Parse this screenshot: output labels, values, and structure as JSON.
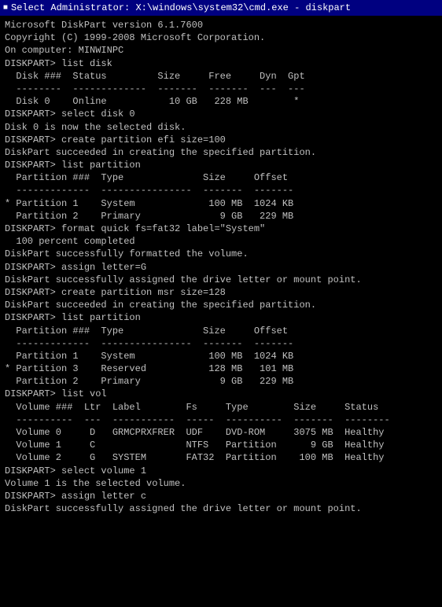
{
  "titleBar": {
    "label": "Select Administrator: X:\\windows\\system32\\cmd.exe - diskpart"
  },
  "console": {
    "lines": [
      "Microsoft DiskPart version 6.1.7600",
      "Copyright (C) 1999-2008 Microsoft Corporation.",
      "On computer: MINWINPC",
      "",
      "DISKPART> list disk",
      "",
      "  Disk ###  Status         Size     Free     Dyn  Gpt",
      "  --------  -------------  -------  -------  ---  ---",
      "  Disk 0    Online           10 GB   228 MB        *",
      "",
      "DISKPART> select disk 0",
      "",
      "Disk 0 is now the selected disk.",
      "",
      "DISKPART> create partition efi size=100",
      "",
      "DiskPart succeeded in creating the specified partition.",
      "",
      "DISKPART> list partition",
      "",
      "  Partition ###  Type              Size     Offset",
      "  -------------  ----------------  -------  -------",
      "* Partition 1    System             100 MB  1024 KB",
      "  Partition 2    Primary              9 GB   229 MB",
      "",
      "DISKPART> format quick fs=fat32 label=\"System\"",
      "",
      "  100 percent completed",
      "",
      "DiskPart successfully formatted the volume.",
      "",
      "DISKPART> assign letter=G",
      "",
      "DiskPart successfully assigned the drive letter or mount point.",
      "",
      "DISKPART> create partition msr size=128",
      "",
      "DiskPart succeeded in creating the specified partition.",
      "",
      "DISKPART> list partition",
      "",
      "  Partition ###  Type              Size     Offset",
      "  -------------  ----------------  -------  -------",
      "  Partition 1    System             100 MB  1024 KB",
      "* Partition 3    Reserved           128 MB   101 MB",
      "  Partition 2    Primary              9 GB   229 MB",
      "",
      "DISKPART> list vol",
      "",
      "  Volume ###  Ltr  Label        Fs     Type        Size     Status",
      "  ----------  ---  -----------  -----  ----------  -------  --------",
      "  Volume 0     D   GRMCPRXFRER  UDF    DVD-ROM     3075 MB  Healthy",
      "  Volume 1     C                NTFS   Partition      9 GB  Healthy",
      "  Volume 2     G   SYSTEM       FAT32  Partition    100 MB  Healthy",
      "",
      "DISKPART> select volume 1",
      "",
      "Volume 1 is the selected volume.",
      "",
      "DISKPART> assign letter c",
      "",
      "DiskPart successfully assigned the drive letter or mount point."
    ]
  }
}
